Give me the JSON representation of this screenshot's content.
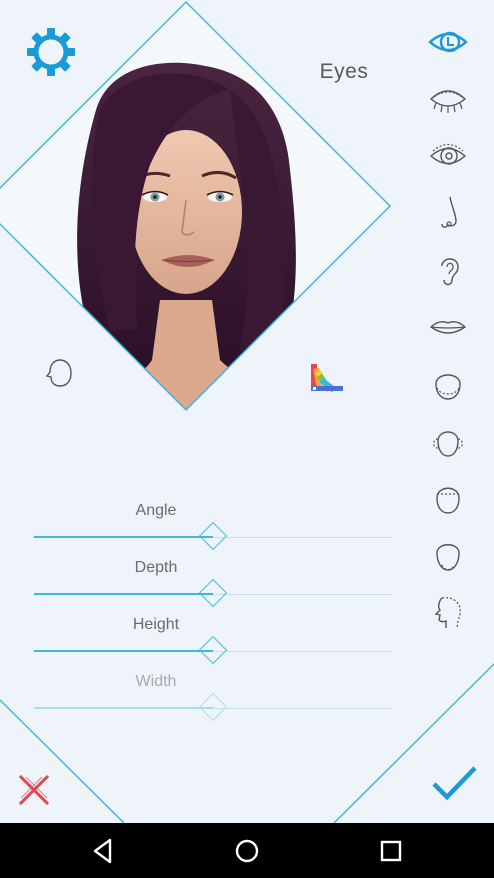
{
  "mode": {
    "title": "Eyes"
  },
  "sliders": [
    {
      "label": "Angle",
      "value": 0.5,
      "active": true
    },
    {
      "label": "Depth",
      "value": 0.5,
      "active": true
    },
    {
      "label": "Height",
      "value": 0.5,
      "active": true
    },
    {
      "label": "Width",
      "value": 0.5,
      "active": false
    }
  ],
  "features": [
    {
      "icon": "eye-color-icon",
      "selected": true
    },
    {
      "icon": "eyelid-icon"
    },
    {
      "icon": "eye-icon"
    },
    {
      "icon": "nose-icon"
    },
    {
      "icon": "ear-icon"
    },
    {
      "icon": "lips-icon"
    },
    {
      "icon": "jaw-icon"
    },
    {
      "icon": "cheeks-icon"
    },
    {
      "icon": "forehead-icon"
    },
    {
      "icon": "chin-icon"
    },
    {
      "icon": "profile-icon"
    }
  ],
  "colors": {
    "accent": "#3fb8dc",
    "cancel": "#e0484f",
    "text": "#5a5a5a",
    "background": "#eef4fa"
  }
}
